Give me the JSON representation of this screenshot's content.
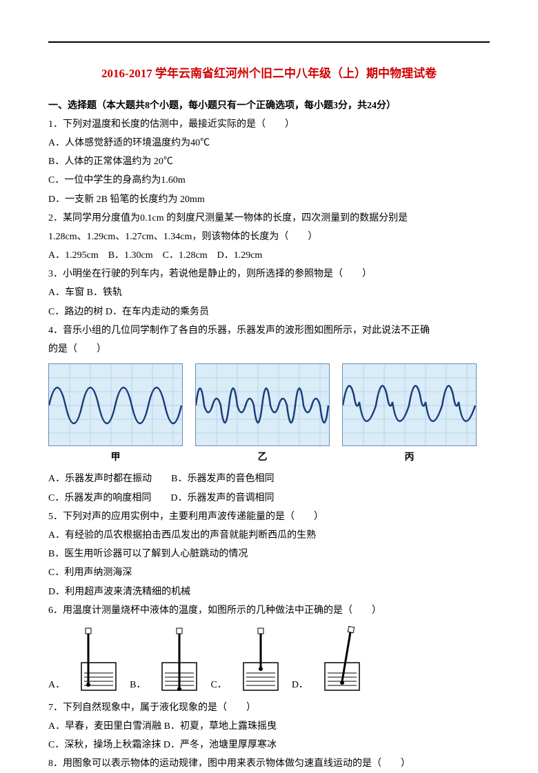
{
  "title": "2016-2017 学年云南省红河州个旧二中八年级（上）期中物理试卷",
  "section1": "一、选择题（本大题共8个小题，每小题只有一个正确选项，每小题3分，共24分）",
  "q1": "1．下列对温度和长度的估测中，最接近实际的是（　　）",
  "q1a": "A．人体感觉舒适的环境温度约为40℃",
  "q1b": "B．人体的正常体温约为 20℃",
  "q1c": "C．一位中学生的身高约为1.60m",
  "q1d": "D．一支新 2B 铅笔的长度约为 20mm",
  "q2": "2．某同学用分度值为0.1cm 的刻度尺测量某一物体的长度，四次测量到的数据分别是",
  "q2line2": "1.28cm、1.29cm、1.27cm、1.34cm，则该物体的长度为（　　）",
  "q2opts": "A．1.295cm　B．1.30cm　C．1.28cm　D．1.29cm",
  "q3": "3．小明坐在行驶的列车内，若说他是静止的，则所选择的参照物是（　　）",
  "q3ab": "A．车窗  B．铁轨",
  "q3cd": "C．路边的树  D．在车内走动的乘务员",
  "q4": "4．音乐小组的几位同学制作了各自的乐器，乐器发声的波形图如图所示，对此说法不正确",
  "q4line2": "的是（　　）",
  "wave_labels": {
    "a": "甲",
    "b": "乙",
    "c": "丙"
  },
  "q4a": "A．乐器发声时都在振动　　B．乐器发声的音色相同",
  "q4c": "C．乐器发声的响度相同　　D．乐器发声的音调相同",
  "q5": "5．下列对声的应用实例中，主要利用声波传递能量的是（　　）",
  "q5a": "A．有经验的瓜农根据拍击西瓜发出的声音就能判断西瓜的生熟",
  "q5b": "B．医生用听诊器可以了解到人心脏跳动的情况",
  "q5c": "C．利用声纳测海深",
  "q5d": "D．利用超声波来清洗精细的机械",
  "q6": "6．用温度计测量烧杯中液体的温度，如图所示的几种做法中正确的是（　　）",
  "beaker_opts": {
    "a": "A．",
    "b": "B．",
    "c": "C．",
    "d": "D．"
  },
  "q7": "7．下列自然现象中，属于液化现象的是（　　）",
  "q7ab": "A．早春，麦田里白雪消融  B．初夏，草地上露珠摇曳",
  "q7cd": "C．深秋，操场上秋霜涂抹  D．严冬，池塘里厚厚寒冰",
  "q8": "8．用图象可以表示物体的运动规律，图中用来表示物体做匀速直线运动的是（　　）"
}
